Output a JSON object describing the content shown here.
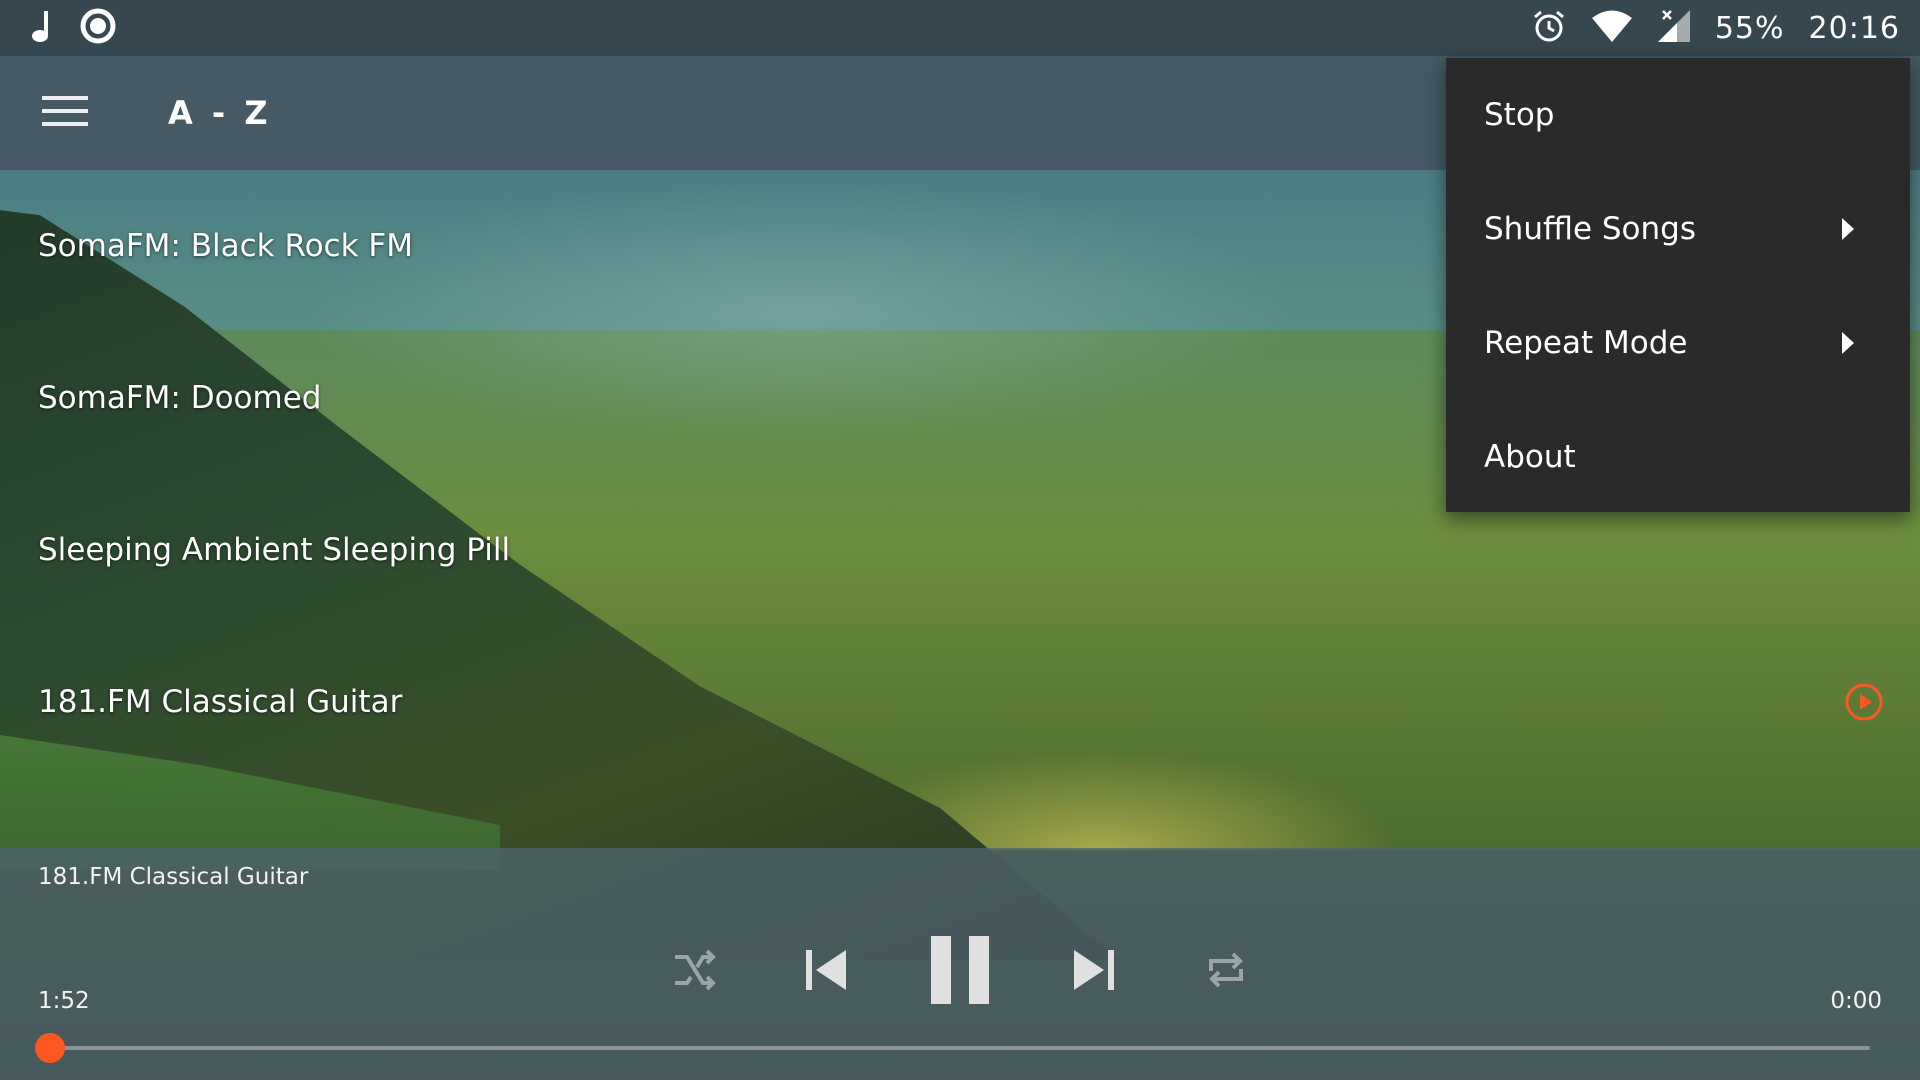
{
  "status_bar": {
    "battery_percent": "55%",
    "time": "20:16",
    "icons": [
      "music-note-icon",
      "record-icon",
      "alarm-icon",
      "wifi-icon",
      "cell-signal-icon"
    ]
  },
  "toolbar": {
    "title": "A - Z"
  },
  "stations": [
    {
      "name": "SomaFM: Black Rock FM"
    },
    {
      "name": "SomaFM: Doomed"
    },
    {
      "name": "Sleeping Ambient Sleeping Pill"
    },
    {
      "name": "181.FM Classical Guitar",
      "playing": true
    }
  ],
  "menu": {
    "items": [
      {
        "label": "Stop"
      },
      {
        "label": "Shuffle Songs",
        "has_submenu": true
      },
      {
        "label": "Repeat Mode",
        "has_submenu": true
      },
      {
        "label": "About"
      }
    ]
  },
  "player": {
    "now_playing": "181.FM Classical Guitar",
    "elapsed": "1:52",
    "remaining": "0:00",
    "progress_fraction": 0.0,
    "state": "playing"
  },
  "colors": {
    "accent": "#ff5722",
    "status_bar": "#37474f",
    "toolbar": "#455a64",
    "menu_bg": "#2a2a2a"
  }
}
